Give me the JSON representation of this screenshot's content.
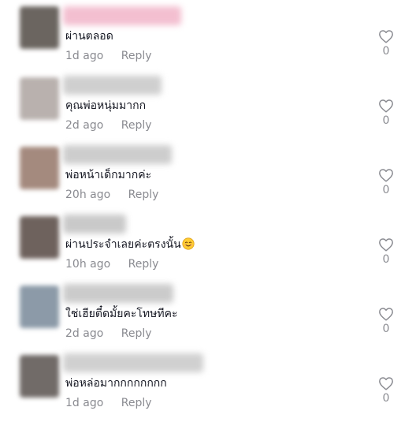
{
  "comments": [
    {
      "text": "ผ่านตลอด",
      "time": "1d ago",
      "reply": "Reply",
      "likes": "0",
      "avatar_color": "#6b6560",
      "name_blur_color": "#f3bfd0",
      "has_emoji": false
    },
    {
      "text": "คุณพ่อหนุ่มมากก",
      "time": "2d ago",
      "reply": "Reply",
      "likes": "0",
      "avatar_color": "#b9b1ae",
      "name_blur_color": "#cfcfcf",
      "has_emoji": false
    },
    {
      "text": "พ่อหน้าเด็กมากค่ะ",
      "time": "20h ago",
      "reply": "Reply",
      "likes": "0",
      "avatar_color": "#a48a7e",
      "name_blur_color": "#cdcdcd",
      "has_emoji": false
    },
    {
      "text": "ผ่านประจำเลยค่ะตรงนั้น",
      "time": "10h ago",
      "reply": "Reply",
      "likes": "0",
      "avatar_color": "#6e625d",
      "name_blur_color": "#c9c9c9",
      "has_emoji": true,
      "emoji": "smiling-face-emoji"
    },
    {
      "text": "ใช่เฮียตี๋ดมั้ยคะโทษทีคะ",
      "time": "2d ago",
      "reply": "Reply",
      "likes": "0",
      "avatar_color": "#8c9aa8",
      "name_blur_color": "#cbcbcb",
      "has_emoji": false
    },
    {
      "text": "พ่อหล่อมากกกกกกกก",
      "time": "1d ago",
      "reply": "Reply",
      "likes": "0",
      "avatar_color": "#716b68",
      "name_blur_color": "#d0d0d0",
      "has_emoji": false
    }
  ],
  "icons": {
    "like": "heart-outline-icon"
  },
  "colors": {
    "text": "#161823",
    "muted": "#8a8b91"
  }
}
